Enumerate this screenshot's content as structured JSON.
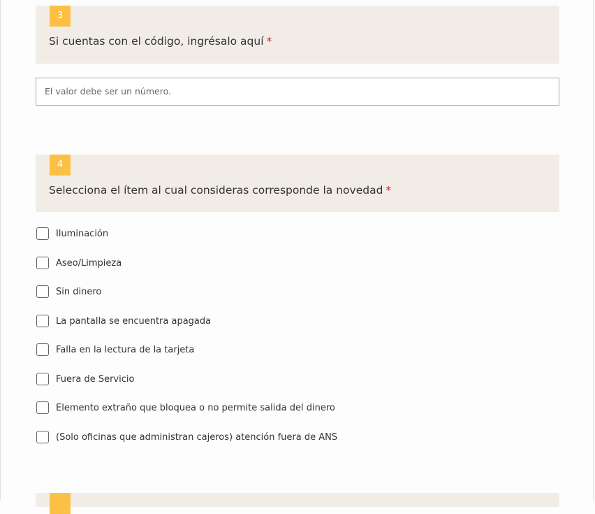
{
  "questions": [
    {
      "number": "3",
      "title": "Si cuentas con el código, ingrésalo aquí",
      "required_mark": "*",
      "input_placeholder": "El valor debe ser un número."
    },
    {
      "number": "4",
      "title": "Selecciona el ítem al cual consideras corresponde la novedad",
      "required_mark": "*",
      "options": [
        "Iluminación",
        "Aseo/Limpieza",
        "Sin dinero",
        "La pantalla se encuentra apagada",
        "Falla en la lectura de la tarjeta",
        "Fuera de Servicio",
        "Elemento extraño que bloquea o no permite salida del dinero",
        "(Solo oficinas que administran cajeros) atención fuera de ANS"
      ]
    }
  ],
  "colors": {
    "badge": "#fcc144",
    "header_bg": "#f1ede6",
    "required": "#c4262e"
  }
}
